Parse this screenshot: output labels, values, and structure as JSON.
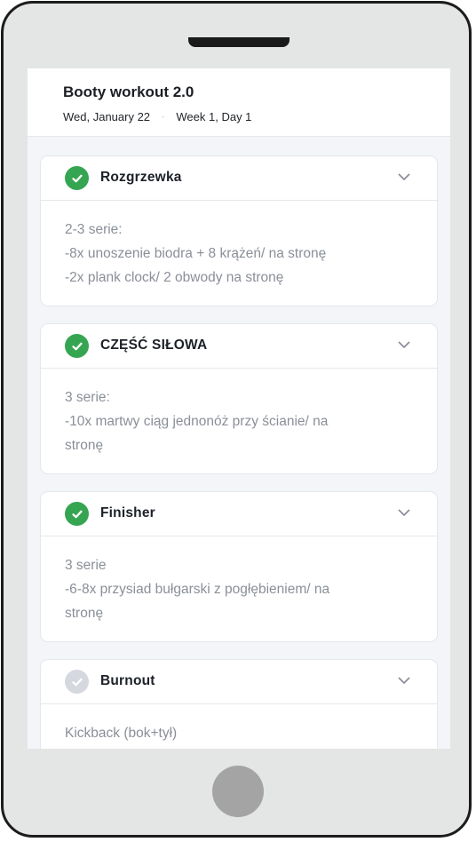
{
  "header": {
    "title": "Booty workout 2.0",
    "date": "Wed, January 22",
    "separator": "·",
    "week_day": "Week 1, Day 1"
  },
  "sections": [
    {
      "title": "Rozgrzewka",
      "status": "done",
      "lines": [
        "2-3 serie:",
        "-8x unoszenie biodra + 8 krążeń/ na stronę",
        "-2x plank clock/ 2 obwody na stronę"
      ]
    },
    {
      "title": "CZĘŚĆ SIŁOWA",
      "status": "done",
      "lines": [
        "3 serie:",
        "-10x martwy ciąg jednonóż przy ścianie/ na",
        "stronę"
      ]
    },
    {
      "title": "Finisher",
      "status": "done",
      "lines": [
        "3 serie",
        "-6-8x przysiad bułgarski z pogłębieniem/ na",
        "stronę"
      ]
    },
    {
      "title": "Burnout",
      "status": "pending",
      "lines": [
        "Kickback (bok+tył)"
      ]
    }
  ],
  "icons": {
    "check": "check-icon",
    "chevron": "chevron-down-icon"
  },
  "colors": {
    "done": "#35a552",
    "pending": "#d5d8de",
    "body_text": "#8a8f98"
  }
}
